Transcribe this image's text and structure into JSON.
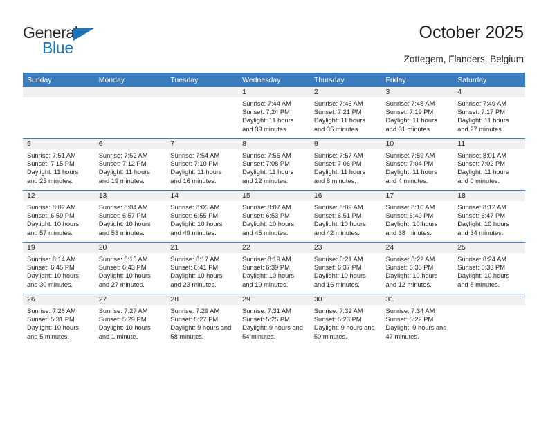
{
  "brand": {
    "name_part1": "General",
    "name_part2": "Blue",
    "accent_color": "#1b75bb",
    "triangle_icon": "triangle-icon"
  },
  "header": {
    "title": "October 2025",
    "location": "Zottegem, Flanders, Belgium"
  },
  "calendar": {
    "header_bg": "#3a7cbe",
    "date_strip_bg": "#f0f0f0",
    "weekdays": [
      "Sunday",
      "Monday",
      "Tuesday",
      "Wednesday",
      "Thursday",
      "Friday",
      "Saturday"
    ],
    "weeks": [
      [
        {
          "date": "",
          "sunrise": "",
          "sunset": "",
          "daylight": ""
        },
        {
          "date": "",
          "sunrise": "",
          "sunset": "",
          "daylight": ""
        },
        {
          "date": "",
          "sunrise": "",
          "sunset": "",
          "daylight": ""
        },
        {
          "date": "1",
          "sunrise": "Sunrise: 7:44 AM",
          "sunset": "Sunset: 7:24 PM",
          "daylight": "Daylight: 11 hours and 39 minutes."
        },
        {
          "date": "2",
          "sunrise": "Sunrise: 7:46 AM",
          "sunset": "Sunset: 7:21 PM",
          "daylight": "Daylight: 11 hours and 35 minutes."
        },
        {
          "date": "3",
          "sunrise": "Sunrise: 7:48 AM",
          "sunset": "Sunset: 7:19 PM",
          "daylight": "Daylight: 11 hours and 31 minutes."
        },
        {
          "date": "4",
          "sunrise": "Sunrise: 7:49 AM",
          "sunset": "Sunset: 7:17 PM",
          "daylight": "Daylight: 11 hours and 27 minutes."
        }
      ],
      [
        {
          "date": "5",
          "sunrise": "Sunrise: 7:51 AM",
          "sunset": "Sunset: 7:15 PM",
          "daylight": "Daylight: 11 hours and 23 minutes."
        },
        {
          "date": "6",
          "sunrise": "Sunrise: 7:52 AM",
          "sunset": "Sunset: 7:12 PM",
          "daylight": "Daylight: 11 hours and 19 minutes."
        },
        {
          "date": "7",
          "sunrise": "Sunrise: 7:54 AM",
          "sunset": "Sunset: 7:10 PM",
          "daylight": "Daylight: 11 hours and 16 minutes."
        },
        {
          "date": "8",
          "sunrise": "Sunrise: 7:56 AM",
          "sunset": "Sunset: 7:08 PM",
          "daylight": "Daylight: 11 hours and 12 minutes."
        },
        {
          "date": "9",
          "sunrise": "Sunrise: 7:57 AM",
          "sunset": "Sunset: 7:06 PM",
          "daylight": "Daylight: 11 hours and 8 minutes."
        },
        {
          "date": "10",
          "sunrise": "Sunrise: 7:59 AM",
          "sunset": "Sunset: 7:04 PM",
          "daylight": "Daylight: 11 hours and 4 minutes."
        },
        {
          "date": "11",
          "sunrise": "Sunrise: 8:01 AM",
          "sunset": "Sunset: 7:02 PM",
          "daylight": "Daylight: 11 hours and 0 minutes."
        }
      ],
      [
        {
          "date": "12",
          "sunrise": "Sunrise: 8:02 AM",
          "sunset": "Sunset: 6:59 PM",
          "daylight": "Daylight: 10 hours and 57 minutes."
        },
        {
          "date": "13",
          "sunrise": "Sunrise: 8:04 AM",
          "sunset": "Sunset: 6:57 PM",
          "daylight": "Daylight: 10 hours and 53 minutes."
        },
        {
          "date": "14",
          "sunrise": "Sunrise: 8:05 AM",
          "sunset": "Sunset: 6:55 PM",
          "daylight": "Daylight: 10 hours and 49 minutes."
        },
        {
          "date": "15",
          "sunrise": "Sunrise: 8:07 AM",
          "sunset": "Sunset: 6:53 PM",
          "daylight": "Daylight: 10 hours and 45 minutes."
        },
        {
          "date": "16",
          "sunrise": "Sunrise: 8:09 AM",
          "sunset": "Sunset: 6:51 PM",
          "daylight": "Daylight: 10 hours and 42 minutes."
        },
        {
          "date": "17",
          "sunrise": "Sunrise: 8:10 AM",
          "sunset": "Sunset: 6:49 PM",
          "daylight": "Daylight: 10 hours and 38 minutes."
        },
        {
          "date": "18",
          "sunrise": "Sunrise: 8:12 AM",
          "sunset": "Sunset: 6:47 PM",
          "daylight": "Daylight: 10 hours and 34 minutes."
        }
      ],
      [
        {
          "date": "19",
          "sunrise": "Sunrise: 8:14 AM",
          "sunset": "Sunset: 6:45 PM",
          "daylight": "Daylight: 10 hours and 30 minutes."
        },
        {
          "date": "20",
          "sunrise": "Sunrise: 8:15 AM",
          "sunset": "Sunset: 6:43 PM",
          "daylight": "Daylight: 10 hours and 27 minutes."
        },
        {
          "date": "21",
          "sunrise": "Sunrise: 8:17 AM",
          "sunset": "Sunset: 6:41 PM",
          "daylight": "Daylight: 10 hours and 23 minutes."
        },
        {
          "date": "22",
          "sunrise": "Sunrise: 8:19 AM",
          "sunset": "Sunset: 6:39 PM",
          "daylight": "Daylight: 10 hours and 19 minutes."
        },
        {
          "date": "23",
          "sunrise": "Sunrise: 8:21 AM",
          "sunset": "Sunset: 6:37 PM",
          "daylight": "Daylight: 10 hours and 16 minutes."
        },
        {
          "date": "24",
          "sunrise": "Sunrise: 8:22 AM",
          "sunset": "Sunset: 6:35 PM",
          "daylight": "Daylight: 10 hours and 12 minutes."
        },
        {
          "date": "25",
          "sunrise": "Sunrise: 8:24 AM",
          "sunset": "Sunset: 6:33 PM",
          "daylight": "Daylight: 10 hours and 8 minutes."
        }
      ],
      [
        {
          "date": "26",
          "sunrise": "Sunrise: 7:26 AM",
          "sunset": "Sunset: 5:31 PM",
          "daylight": "Daylight: 10 hours and 5 minutes."
        },
        {
          "date": "27",
          "sunrise": "Sunrise: 7:27 AM",
          "sunset": "Sunset: 5:29 PM",
          "daylight": "Daylight: 10 hours and 1 minute."
        },
        {
          "date": "28",
          "sunrise": "Sunrise: 7:29 AM",
          "sunset": "Sunset: 5:27 PM",
          "daylight": "Daylight: 9 hours and 58 minutes."
        },
        {
          "date": "29",
          "sunrise": "Sunrise: 7:31 AM",
          "sunset": "Sunset: 5:25 PM",
          "daylight": "Daylight: 9 hours and 54 minutes."
        },
        {
          "date": "30",
          "sunrise": "Sunrise: 7:32 AM",
          "sunset": "Sunset: 5:23 PM",
          "daylight": "Daylight: 9 hours and 50 minutes."
        },
        {
          "date": "31",
          "sunrise": "Sunrise: 7:34 AM",
          "sunset": "Sunset: 5:22 PM",
          "daylight": "Daylight: 9 hours and 47 minutes."
        },
        {
          "date": "",
          "sunrise": "",
          "sunset": "",
          "daylight": ""
        }
      ]
    ]
  }
}
